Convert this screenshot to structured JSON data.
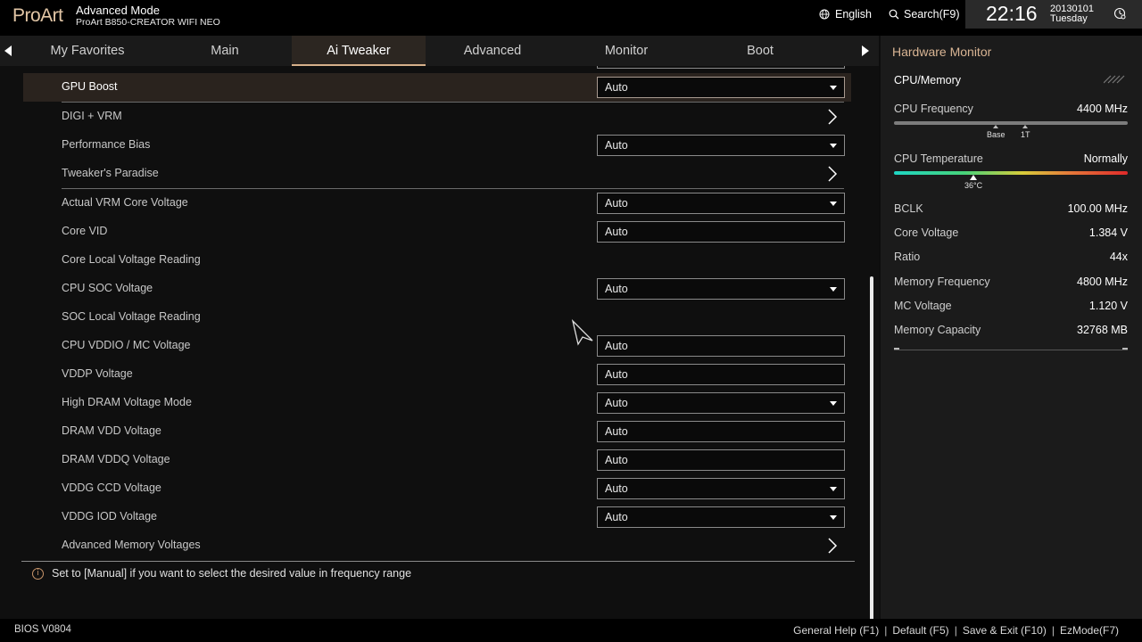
{
  "header": {
    "logo": "ProArt",
    "mode": "Advanced Mode",
    "board": "ProArt B850-CREATOR WIFI NEO",
    "language": "English",
    "search": "Search(F9)",
    "time": "22:16",
    "date": "20130101",
    "weekday": "Tuesday"
  },
  "tabs": [
    "My Favorites",
    "Main",
    "Ai Tweaker",
    "Advanced",
    "Monitor",
    "Boot"
  ],
  "active_tab": "Ai Tweaker",
  "rows": [
    {
      "label": "GPU Boost",
      "value": "Auto",
      "type": "dropdown"
    },
    {
      "label": "DIGI + VRM",
      "type": "submenu"
    },
    {
      "label": "Performance Bias",
      "value": "Auto",
      "type": "dropdown"
    },
    {
      "label": "Tweaker's Paradise",
      "type": "submenu"
    },
    {
      "label": "Actual VRM Core Voltage",
      "value": "Auto",
      "type": "dropdown"
    },
    {
      "label": "Core VID",
      "value": "Auto",
      "type": "input"
    },
    {
      "label": "Core Local Voltage Reading",
      "type": "text"
    },
    {
      "label": "CPU SOC Voltage",
      "value": "Auto",
      "type": "dropdown"
    },
    {
      "label": "SOC Local Voltage Reading",
      "type": "text"
    },
    {
      "label": "CPU VDDIO / MC Voltage",
      "value": "Auto",
      "type": "input"
    },
    {
      "label": "VDDP Voltage",
      "value": "Auto",
      "type": "input"
    },
    {
      "label": "High DRAM Voltage Mode",
      "value": "Auto",
      "type": "dropdown"
    },
    {
      "label": "DRAM VDD Voltage",
      "value": "Auto",
      "type": "input"
    },
    {
      "label": "DRAM VDDQ Voltage",
      "value": "Auto",
      "type": "input"
    },
    {
      "label": "VDDG CCD Voltage",
      "value": "Auto",
      "type": "dropdown"
    },
    {
      "label": "VDDG IOD Voltage",
      "value": "Auto",
      "type": "dropdown"
    },
    {
      "label": "Advanced Memory Voltages",
      "type": "submenu"
    }
  ],
  "help_text": "Set to [Manual] if you want to select the desired value in frequency range",
  "hardware_monitor": {
    "title": "Hardware Monitor",
    "section": "CPU/Memory",
    "cpu_frequency_label": "CPU Frequency",
    "cpu_frequency_value": "4400 MHz",
    "marker_base": "Base",
    "marker_1t": "1T",
    "cpu_temp_label": "CPU Temperature",
    "cpu_temp_value": "Normally",
    "cpu_temp_reading": "36°C",
    "stats": [
      {
        "label": "BCLK",
        "value": "100.00 MHz"
      },
      {
        "label": "Core Voltage",
        "value": "1.384 V"
      },
      {
        "label": "Ratio",
        "value": "44x"
      },
      {
        "label": "Memory Frequency",
        "value": "4800 MHz"
      },
      {
        "label": "MC Voltage",
        "value": "1.120 V"
      },
      {
        "label": "Memory Capacity",
        "value": "32768 MB"
      }
    ]
  },
  "footer": {
    "bios_version": "BIOS V0804",
    "general_help": "General Help (F1)",
    "default": "Default (F5)",
    "save_exit": "Save & Exit (F10)",
    "ezmode": "EzMode(F7)"
  },
  "colors": {
    "accent": "#d9b594",
    "active_tab_bg": "#2c2621",
    "highlight_row_bg": "#2a231e",
    "panel_bg": "#1b1b1b"
  }
}
